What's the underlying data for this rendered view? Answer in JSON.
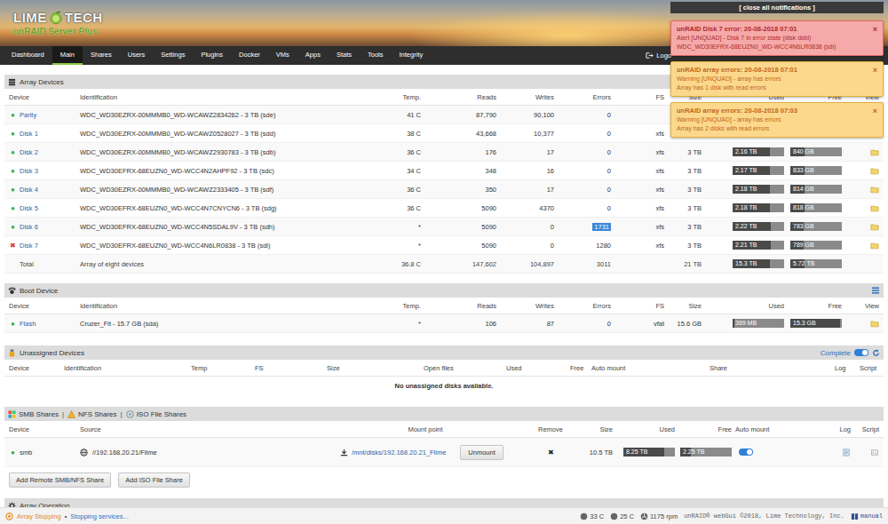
{
  "header": {
    "logo_left": "LIME",
    "logo_right": "TECH",
    "server": "unRAID Server",
    "edition": "Plus"
  },
  "nav": {
    "tabs": [
      {
        "label": "Dashboard",
        "selected": false
      },
      {
        "label": "Main",
        "selected": true
      },
      {
        "label": "Shares",
        "selected": false
      },
      {
        "label": "Users",
        "selected": false
      },
      {
        "label": "Settings",
        "selected": false
      },
      {
        "label": "Plugins",
        "selected": false
      },
      {
        "label": "Docker",
        "selected": false
      },
      {
        "label": "VMs",
        "selected": false
      },
      {
        "label": "Apps",
        "selected": false
      },
      {
        "label": "Stats",
        "selected": false
      },
      {
        "label": "Tools",
        "selected": false
      },
      {
        "label": "Integrity",
        "selected": false
      }
    ],
    "right": {
      "label": "Logo"
    }
  },
  "notifications": {
    "close_all": "[ close all notifications ]",
    "items": [
      {
        "kind": "alert",
        "title": "unRAID Disk 7 error: 20-08-2018 07:01",
        "lines": [
          "Alert [UNQUAD] - Disk 7 in error state (disk dsbl)",
          "WDC_WD30EFRX-68EUZN0_WD-WCC4N6LR0838 (sdi)"
        ],
        "close": "×"
      },
      {
        "kind": "warning",
        "title": "unRAID array errors: 20-08-2018 07:01",
        "lines": [
          "Warning [UNQUAD] - array has errors",
          "Array has 1 disk with read errors"
        ],
        "close": "×"
      },
      {
        "kind": "warning",
        "title": "unRAID array errors: 20-08-2018 07:03",
        "lines": [
          "Warning [UNQUAD] - array has errors",
          "Array has 2 disks with read errors"
        ],
        "close": "×"
      }
    ]
  },
  "array": {
    "title": "Array Devices",
    "columns": [
      "Device",
      "Identification",
      "Temp.",
      "Reads",
      "Writes",
      "Errors",
      "FS",
      "Size",
      "Used",
      "Free",
      "View"
    ],
    "rows": [
      {
        "status": "●",
        "color": "#3cb043",
        "device": "Parity",
        "identification": "WDC_WD30EZRX-00MMMB0_WD-WCAWZ2834262 - 3 TB (sde)",
        "temp": "41 C",
        "reads": "87,790",
        "writes": "90,100",
        "errors": "0",
        "errors_highlighted": false,
        "fs": "",
        "size": "",
        "used": null,
        "free": null,
        "view": false
      },
      {
        "status": "●",
        "color": "#3cb043",
        "device": "Disk 1",
        "identification": "WDC_WD30EZRX-00MMMB0_WD-WCAWZ0528027 - 3 TB (sdd)",
        "temp": "38 C",
        "reads": "43,668",
        "writes": "10,377",
        "errors": "0",
        "errors_highlighted": false,
        "fs": "xfs",
        "size": "",
        "used": null,
        "free": null,
        "view": false
      },
      {
        "status": "●",
        "color": "#3cb043",
        "device": "Disk 2",
        "identification": "WDC_WD30EZRX-00MMMB0_WD-WCAWZ2930783 - 3 TB (sdb)",
        "temp": "36 C",
        "reads": "176",
        "writes": "17",
        "errors": "0",
        "errors_highlighted": false,
        "fs": "xfs",
        "size": "3 TB",
        "used": {
          "text": "2.16 TB",
          "level": 0.72
        },
        "free": {
          "text": "840 GB",
          "level": 0.28
        },
        "view": true
      },
      {
        "status": "●",
        "color": "#3cb043",
        "device": "Disk 3",
        "identification": "WDC_WD30EFRX-68EUZN0_WD-WCC4N2AHPF92 - 3 TB (sdc)",
        "temp": "34 C",
        "reads": "348",
        "writes": "16",
        "errors": "0",
        "errors_highlighted": false,
        "fs": "xfs",
        "size": "3 TB",
        "used": {
          "text": "2.17 TB",
          "level": 0.72
        },
        "free": {
          "text": "833 GB",
          "level": 0.28
        },
        "view": true
      },
      {
        "status": "●",
        "color": "#3cb043",
        "device": "Disk 4",
        "identification": "WDC_WD30EZRX-00MMMB0_WD-WCAWZ2333405 - 3 TB (sdf)",
        "temp": "36 C",
        "reads": "350",
        "writes": "17",
        "errors": "0",
        "errors_highlighted": false,
        "fs": "xfs",
        "size": "3 TB",
        "used": {
          "text": "2.18 TB",
          "level": 0.73
        },
        "free": {
          "text": "814 GB",
          "level": 0.27
        },
        "view": true
      },
      {
        "status": "●",
        "color": "#3cb043",
        "device": "Disk 5",
        "identification": "WDC_WD30EFRX-68EUZN0_WD-WCC4N7CNYCN6 - 3 TB (sdg)",
        "temp": "36 C",
        "reads": "5090",
        "writes": "4370",
        "errors": "0",
        "errors_highlighted": false,
        "fs": "xfs",
        "size": "3 TB",
        "used": {
          "text": "2.18 TB",
          "level": 0.73
        },
        "free": {
          "text": "818 GB",
          "level": 0.27
        },
        "view": true
      },
      {
        "status": "●",
        "color": "#3cb043",
        "device": "Disk 6",
        "identification": "WDC_WD30EFRX-68EUZN0_WD-WCC4N5SDAL9V - 3 TB (sdh)",
        "temp": "*",
        "reads": "5090",
        "writes": "0",
        "errors": "1731",
        "errors_highlighted": true,
        "fs": "xfs",
        "size": "3 TB",
        "used": {
          "text": "2.22 TB",
          "level": 0.74
        },
        "free": {
          "text": "783 GB",
          "level": 0.26
        },
        "view": true
      },
      {
        "status": "✖",
        "color": "#e0342c",
        "device": "Disk 7",
        "identification": "WDC_WD30EFRX-68EUZN0_WD-WCC4N6LR0838 - 3 TB (sdi)",
        "temp": "*",
        "reads": "5090",
        "writes": "0",
        "errors": "1280",
        "errors_highlighted": false,
        "fs": "xfs",
        "size": "3 TB",
        "used": {
          "text": "2.21 TB",
          "level": 0.74
        },
        "free": {
          "text": "789 GB",
          "level": 0.26
        },
        "view": true
      }
    ],
    "total": {
      "device": "Total",
      "identification": "Array of eight devices",
      "temp": "36.8 C",
      "reads": "147,602",
      "writes": "104,897",
      "errors": "3011",
      "fs": "",
      "size": "21 TB",
      "used": {
        "text": "15.3 TB",
        "level": 0.73
      },
      "free": {
        "text": "5.72 TB",
        "level": 0.27
      }
    }
  },
  "boot": {
    "title": "Boot Device",
    "columns": [
      "Device",
      "Identification",
      "Temp.",
      "Reads",
      "Writes",
      "Errors",
      "FS",
      "Size",
      "Used",
      "Free",
      "View"
    ],
    "rows": [
      {
        "status": "●",
        "color": "#3cb043",
        "device": "Flash",
        "identification": "Cruzer_Fit - 15.7 GB (sda)",
        "temp": "*",
        "reads": "106",
        "writes": "87",
        "errors": "0",
        "fs": "vfat",
        "size": "15.6 GB",
        "used": {
          "text": "369 MB",
          "level": 0.03
        },
        "free": {
          "text": "15.3 GB",
          "level": 0.97
        },
        "view": true
      }
    ]
  },
  "unassigned": {
    "title": "Unassigned Devices",
    "complete_label": "Complete",
    "complete_on": true,
    "columns": [
      "Device",
      "Identification",
      "Temp",
      "FS",
      "Size",
      "Open files",
      "Used",
      "Free",
      "Auto mount",
      "Share",
      "Log",
      "Script"
    ],
    "empty": "No unassigned disks available."
  },
  "shares": {
    "tabs": [
      {
        "label": "SMB Shares",
        "selected": true
      },
      {
        "label": "NFS Shares",
        "selected": false
      },
      {
        "label": "ISO File Shares",
        "selected": false
      }
    ],
    "separator": "|",
    "columns": [
      "Device",
      "Source",
      "Mount point",
      "Remove",
      "Size",
      "Used",
      "Free",
      "Auto mount",
      "Log",
      "Script"
    ],
    "rows": [
      {
        "status": "●",
        "color": "#3cb043",
        "device": "smb",
        "source": "//192.168.20.21/Filme",
        "mount_point": "/mnt/disks/192.168.20.21_Filme",
        "button": "Unmount",
        "remove": "✖",
        "size": "10.5 TB",
        "used": {
          "text": "8.25 TB",
          "level": 0.79
        },
        "free": {
          "text": "2.25 TB",
          "level": 0.21
        },
        "auto_mount": true
      }
    ],
    "buttons": [
      "Add Remote SMB/NFS Share",
      "Add ISO File Share"
    ]
  },
  "array_operation": {
    "title": "Array Operation"
  },
  "status_bar": {
    "state": "Array Stopping",
    "separator": "•",
    "message": "Stopping services...",
    "readings": [
      "33 C",
      "25 C",
      "1175 rpm"
    ],
    "copyright": "unRAID® webGui ©2018, Lime Technology, Inc.",
    "manual": "manual"
  }
}
